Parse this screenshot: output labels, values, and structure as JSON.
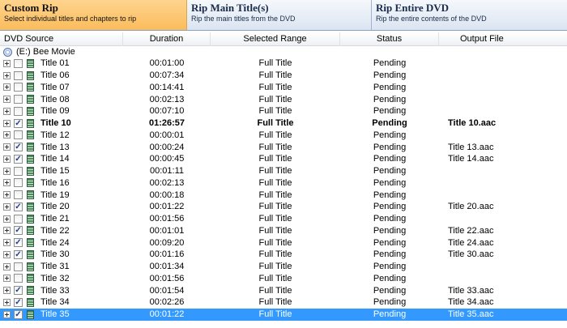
{
  "tabs": [
    {
      "title": "Custom Rip",
      "subtitle": "Select individual titles and chapters to rip",
      "active": true
    },
    {
      "title": "Rip Main Title(s)",
      "subtitle": "Rip the main titles from the DVD",
      "active": false
    },
    {
      "title": "Rip Entire DVD",
      "subtitle": "Rip the entire contents of the DVD",
      "active": false
    }
  ],
  "columns": {
    "source": "DVD Source",
    "duration": "Duration",
    "range": "Selected Range",
    "status": "Status",
    "output": "Output File"
  },
  "drive": {
    "label": "(E:) Bee Movie",
    "icon": "disc-icon"
  },
  "rows": [
    {
      "title": "Title 01",
      "duration": "00:01:00",
      "range": "Full Title",
      "status": "Pending",
      "output": "",
      "checked": false
    },
    {
      "title": "Title 06",
      "duration": "00:07:34",
      "range": "Full Title",
      "status": "Pending",
      "output": "",
      "checked": false
    },
    {
      "title": "Title 07",
      "duration": "00:14:41",
      "range": "Full Title",
      "status": "Pending",
      "output": "",
      "checked": false
    },
    {
      "title": "Title 08",
      "duration": "00:02:13",
      "range": "Full Title",
      "status": "Pending",
      "output": "",
      "checked": false
    },
    {
      "title": "Title 09",
      "duration": "00:07:10",
      "range": "Full Title",
      "status": "Pending",
      "output": "",
      "checked": false
    },
    {
      "title": "Title 10",
      "duration": "01:26:57",
      "range": "Full Title",
      "status": "Pending",
      "output": "Title 10.aac",
      "checked": true,
      "bold": true
    },
    {
      "title": "Title 12",
      "duration": "00:00:01",
      "range": "Full Title",
      "status": "Pending",
      "output": "",
      "checked": false
    },
    {
      "title": "Title 13",
      "duration": "00:00:24",
      "range": "Full Title",
      "status": "Pending",
      "output": "Title 13.aac",
      "checked": true
    },
    {
      "title": "Title 14",
      "duration": "00:00:45",
      "range": "Full Title",
      "status": "Pending",
      "output": "Title 14.aac",
      "checked": true
    },
    {
      "title": "Title 15",
      "duration": "00:01:11",
      "range": "Full Title",
      "status": "Pending",
      "output": "",
      "checked": false
    },
    {
      "title": "Title 16",
      "duration": "00:02:13",
      "range": "Full Title",
      "status": "Pending",
      "output": "",
      "checked": false
    },
    {
      "title": "Title 19",
      "duration": "00:00:18",
      "range": "Full Title",
      "status": "Pending",
      "output": "",
      "checked": false
    },
    {
      "title": "Title 20",
      "duration": "00:01:22",
      "range": "Full Title",
      "status": "Pending",
      "output": "Title 20.aac",
      "checked": true
    },
    {
      "title": "Title 21",
      "duration": "00:01:56",
      "range": "Full Title",
      "status": "Pending",
      "output": "",
      "checked": false
    },
    {
      "title": "Title 22",
      "duration": "00:01:01",
      "range": "Full Title",
      "status": "Pending",
      "output": "Title 22.aac",
      "checked": true
    },
    {
      "title": "Title 24",
      "duration": "00:09:20",
      "range": "Full Title",
      "status": "Pending",
      "output": "Title 24.aac",
      "checked": true
    },
    {
      "title": "Title 30",
      "duration": "00:01:16",
      "range": "Full Title",
      "status": "Pending",
      "output": "Title 30.aac",
      "checked": true
    },
    {
      "title": "Title 31",
      "duration": "00:01:34",
      "range": "Full Title",
      "status": "Pending",
      "output": "",
      "checked": false
    },
    {
      "title": "Title 32",
      "duration": "00:01:56",
      "range": "Full Title",
      "status": "Pending",
      "output": "",
      "checked": false
    },
    {
      "title": "Title 33",
      "duration": "00:01:54",
      "range": "Full Title",
      "status": "Pending",
      "output": "Title 33.aac",
      "checked": true
    },
    {
      "title": "Title 34",
      "duration": "00:02:26",
      "range": "Full Title",
      "status": "Pending",
      "output": "Title 34.aac",
      "checked": true
    },
    {
      "title": "Title 35",
      "duration": "00:01:22",
      "range": "Full Title",
      "status": "Pending",
      "output": "Title 35.aac",
      "checked": true,
      "selected": true
    }
  ],
  "colors": {
    "active_tab": "#fbbc5c",
    "selection": "#3399ff"
  }
}
